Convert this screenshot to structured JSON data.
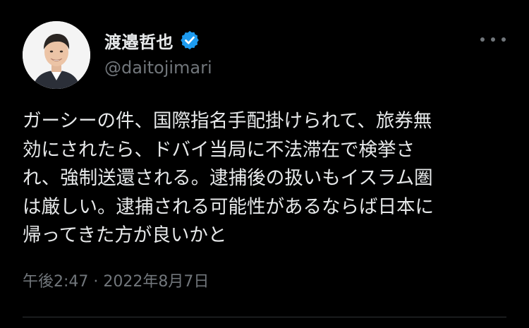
{
  "author": {
    "display_name": "渡邉哲也",
    "handle": "@daitojimari",
    "verified_icon": "verified-badge-icon",
    "verified_color": "#1d9bf0"
  },
  "tweet": {
    "lines": [
      "ガーシーの件、国際指名手配掛けられて、旅券無",
      "効にされたら、ドバイ当局に不法滞在で検挙さ",
      "れ、強制送還される。逮捕後の扱いもイスラム圏",
      "は厳しい。逮捕される可能性があるならば日本に",
      "帰ってきた方が良いかと"
    ],
    "timestamp": "午後2:47 · 2022年8月7日"
  },
  "more_icon": "more-dots-icon",
  "colors": {
    "background": "#000000",
    "text_primary": "#e7e9ea",
    "text_secondary": "#71767b",
    "divider": "#2f3336"
  }
}
